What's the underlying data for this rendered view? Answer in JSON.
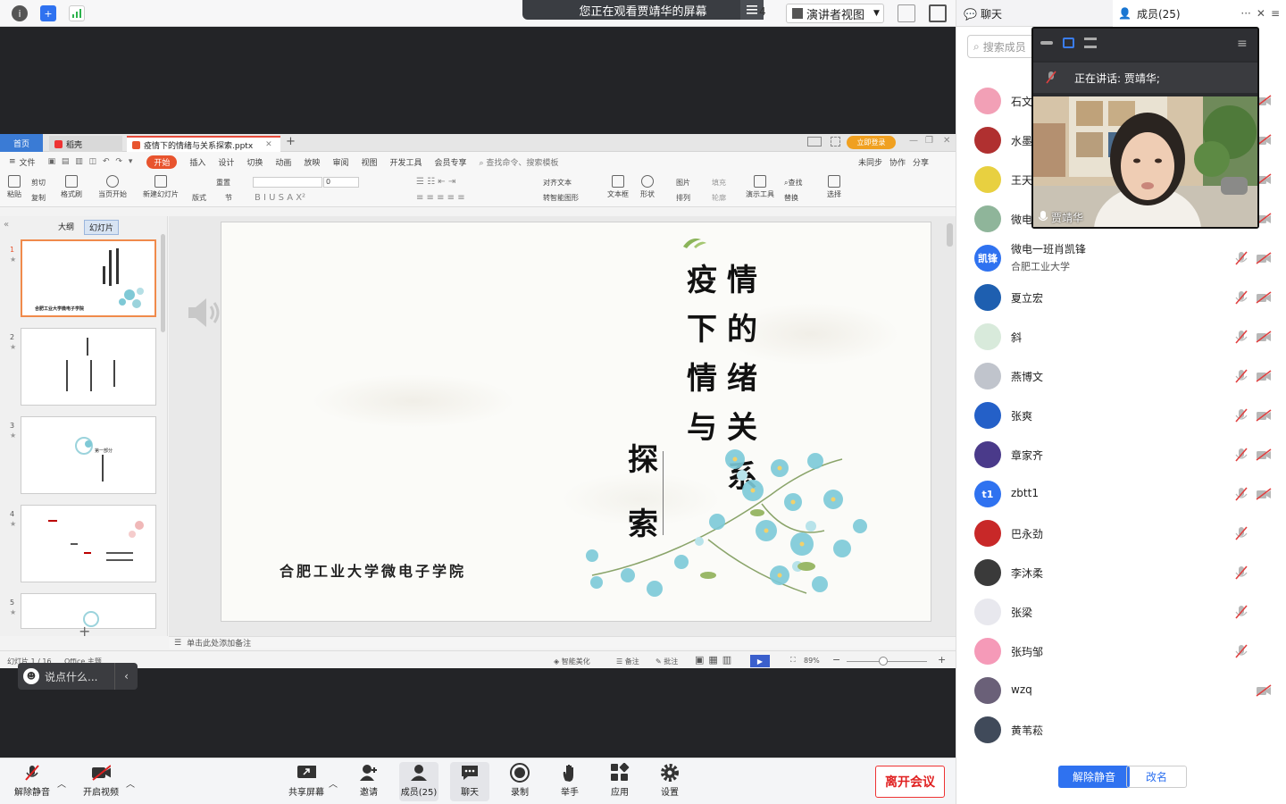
{
  "topbar": {
    "banner_text": "您正在观看贾靖华的屏幕",
    "partial_count": "4",
    "view_label": "演讲者视图",
    "icons": [
      "info-icon",
      "shield-icon",
      "signal-icon",
      "menu-icon",
      "exit-fullscreen-icon",
      "sidebar-icon"
    ]
  },
  "wps": {
    "tabs": {
      "home": "首页",
      "daoke": "稻壳",
      "file": "疫情下的情绪与关系探索.pptx",
      "add": "+"
    },
    "login": "立即登录",
    "menu": {
      "file": "文件",
      "start": "开始",
      "insert": "插入",
      "design": "设计",
      "switch": "切换",
      "animation": "动画",
      "show": "放映",
      "review": "审阅",
      "view": "视图",
      "dev": "开发工具",
      "member": "会员专享",
      "search": "查找命令、搜索模板",
      "sync": "未同步",
      "collab": "协作",
      "share": "分享"
    },
    "ribbon": {
      "paste": "粘贴",
      "cut": "剪切",
      "copy": "复制",
      "format_painter": "格式刷",
      "from_current": "当页开始",
      "new_slide": "新建幻灯片",
      "layout": "版式",
      "section": "节",
      "reset": "重置",
      "font_size": "0",
      "align_text": "对齐文本",
      "smart_shape": "转智能图形",
      "textbox": "文本框",
      "shape": "形状",
      "picture": "图片",
      "fill": "填充",
      "arrange": "排列",
      "outline": "轮廓",
      "tools": "演示工具",
      "find": "查找",
      "replace": "替换",
      "select": "选择"
    },
    "panel": {
      "outline_tab": "大纲",
      "slides_tab": "幻灯片",
      "add": "+"
    },
    "thumbs": [
      {
        "num": "1",
        "college": "合肥工业大学微电子学院"
      },
      {
        "num": "2"
      },
      {
        "num": "3",
        "caption": "第一部分"
      },
      {
        "num": "4"
      },
      {
        "num": "5"
      }
    ],
    "slide": {
      "col1": [
        "情",
        "的",
        "绪",
        "关",
        "系"
      ],
      "col2": [
        "疫",
        "下",
        "情",
        "与"
      ],
      "col3": [
        "探",
        "索"
      ],
      "college": "合肥工业大学微电子学院"
    },
    "notes": "单击此处添加备注",
    "status": {
      "slide_count": "幻灯片 1 / 16",
      "theme": "Office 主题",
      "beautify": "智能美化",
      "notes": "备注",
      "comment": "批注",
      "zoom": "89%"
    }
  },
  "chat_pill": {
    "placeholder": "说点什么..."
  },
  "bottombar": {
    "unmute": "解除静音",
    "video": "开启视频",
    "share": "共享屏幕",
    "invite": "邀请",
    "members": "成员(25)",
    "chat": "聊天",
    "record": "录制",
    "raise_hand": "举手",
    "apps": "应用",
    "settings": "设置",
    "leave": "离开会议"
  },
  "rightpanel": {
    "tab_chat": "聊天",
    "tab_members": "成员(25)",
    "search_placeholder": "搜索成员",
    "unmute_all": "解除静音",
    "rename": "改名",
    "video": {
      "speaking": "正在讲话: 贾靖华;",
      "name": "贾靖华"
    },
    "members": [
      {
        "name": "石文",
        "color": "#f2a0b6",
        "mic": "muted",
        "cam": "off"
      },
      {
        "name": "水墨",
        "color": "#b03030",
        "mic": "muted",
        "cam": "off"
      },
      {
        "name": "王天",
        "color": "#e8d040",
        "mic": "muted",
        "cam": "off"
      },
      {
        "name": "微电",
        "color": "#8fb59a",
        "mic": "muted",
        "cam": "off"
      },
      {
        "name": "微电一班肖凯锋",
        "sub": "合肥工业大学",
        "avatar_text": "凯锋",
        "color": "#2f72f0",
        "mic": "muted",
        "cam": "off"
      },
      {
        "name": "夏立宏",
        "color": "#1e5fb0",
        "mic": "muted",
        "cam": "off"
      },
      {
        "name": "斜",
        "color": "#d8eadb",
        "mic": "muted",
        "cam": "off"
      },
      {
        "name": "燕博文",
        "color": "#c0c4cc",
        "mic": "muted",
        "cam": "off"
      },
      {
        "name": "张爽",
        "color": "#2460c8",
        "mic": "muted",
        "cam": "off"
      },
      {
        "name": "章家齐",
        "color": "#4a3a8a",
        "mic": "muted",
        "cam": "off"
      },
      {
        "name": "zbtt1",
        "avatar_text": "t1",
        "color": "#2f72f0",
        "mic": "muted",
        "cam": "off"
      },
      {
        "name": "巴永劲",
        "color": "#c82828",
        "mic": "muted",
        "cam": "none"
      },
      {
        "name": "李沐柔",
        "color": "#3a3a3a",
        "mic": "muted",
        "cam": "none"
      },
      {
        "name": "张梁",
        "color": "#e8e8ee",
        "mic": "muted",
        "cam": "none"
      },
      {
        "name": "张玙邹",
        "color": "#f59ab8",
        "mic": "muted",
        "cam": "none"
      },
      {
        "name": "wzq",
        "color": "#6a6078",
        "mic": "none",
        "cam": "off"
      },
      {
        "name": "黄苇菘",
        "color": "#404a5a",
        "mic": "none",
        "cam": "none"
      }
    ]
  },
  "colors": {
    "accent": "#2f72f0",
    "danger": "#e02020",
    "wps_orange": "#e8542e",
    "dark": "#232427"
  }
}
